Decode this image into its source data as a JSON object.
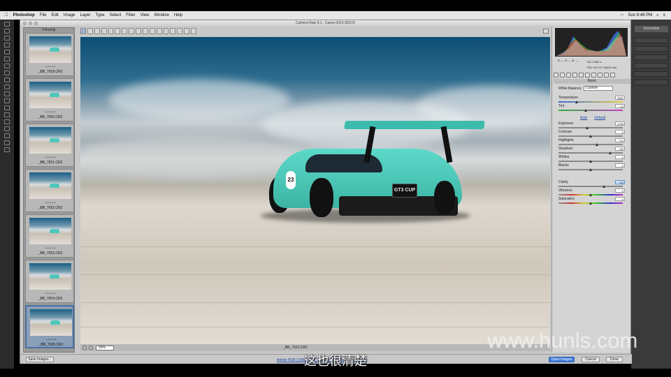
{
  "menubar": {
    "app": "Photoshop",
    "items": [
      "File",
      "Edit",
      "Image",
      "Layer",
      "Type",
      "Select",
      "Filter",
      "View",
      "Window",
      "Help"
    ],
    "clock": "Sun 9:48 PM"
  },
  "ps_panel": {
    "workspace": "Essentials"
  },
  "acr": {
    "title": "Camera Raw 9.1  -  Canon EOS 5DS R",
    "filmstrip_label": "Filmstrip",
    "thumbnails": [
      {
        "name": "_BB_7918.CR2",
        "stars": "• • • • •"
      },
      {
        "name": "_BB_7920.CR2",
        "stars": "• • • • •"
      },
      {
        "name": "_BB_7921.CR2",
        "stars": "• • • • •"
      },
      {
        "name": "_BB_7922.CR2",
        "stars": "• • • • •"
      },
      {
        "name": "_BB_7923.CR2",
        "stars": "• • • • •"
      },
      {
        "name": "_BB_7924.CR2",
        "stars": "• • • • •"
      },
      {
        "name": "_BB_7925.CR2",
        "stars": "• • • • •"
      }
    ],
    "selected_thumbnail_index": 6,
    "preview": {
      "plate": "GT3 CUP",
      "race_number": "23",
      "zoom": "26%",
      "filename": "_BB_7925.CR2"
    },
    "exif": {
      "line1": "f/11   1/250 s",
      "line2": "ISO 100   24-70@33 mm",
      "rgb": "R:  ---   G:  ---   B:  ---"
    },
    "panel": {
      "header": "Basic",
      "white_balance_label": "White Balance:",
      "white_balance_value": "Custom",
      "auto": "Auto",
      "default": "Default",
      "sliders": [
        {
          "label": "Temperature",
          "value": "4850",
          "pos": 0.28
        },
        {
          "label": "Tint",
          "value": "-15",
          "pos": 0.42
        },
        {
          "label": "Exposure",
          "value": "-0.55",
          "pos": 0.45
        },
        {
          "label": "Contrast",
          "value": "0",
          "pos": 0.5
        },
        {
          "label": "Highlights",
          "value": "+19",
          "pos": 0.6
        },
        {
          "label": "Shadows",
          "value": "+60",
          "pos": 0.8
        },
        {
          "label": "Whites",
          "value": "0",
          "pos": 0.5
        },
        {
          "label": "Blacks",
          "value": "0",
          "pos": 0.5
        },
        {
          "label": "Clarity",
          "value": "+42",
          "pos": 0.71,
          "highlighted": true
        },
        {
          "label": "Vibrance",
          "value": "0",
          "pos": 0.5
        },
        {
          "label": "Saturation",
          "value": "0",
          "pos": 0.5
        }
      ]
    },
    "buttons": {
      "save": "Save Images...",
      "workflow": "Adobe RGB (1998); 8 bit; 8688 by 5792 (50.3MP); 300 ppi",
      "open": "Open Images",
      "cancel": "Cancel",
      "done": "Done"
    }
  },
  "watermark": "www.hunls.com",
  "subtitle": "这也很清楚"
}
